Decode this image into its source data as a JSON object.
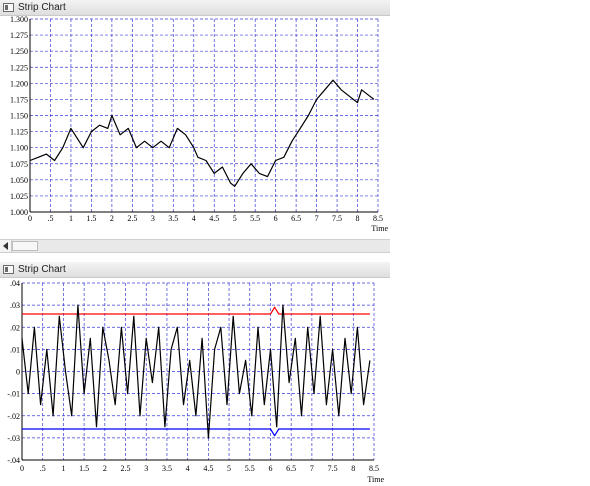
{
  "windows": [
    {
      "title": "Strip Chart"
    },
    {
      "title": "Strip Chart"
    }
  ],
  "chart_data": [
    {
      "type": "line",
      "title": "",
      "xlabel": "Time",
      "ylabel": "",
      "xlim": [
        0,
        8.5
      ],
      "ylim": [
        1.0,
        1.3
      ],
      "grid": true,
      "x_ticks": [
        "0",
        ".5",
        "1",
        "1.5",
        "2",
        "2.5",
        "3",
        "3.5",
        "4",
        "4.5",
        "5",
        "5.5",
        "6",
        "6.5",
        "7",
        "7.5",
        "8",
        "8.5"
      ],
      "y_ticks": [
        "1.000",
        "1.025",
        "1.050",
        "1.075",
        "1.100",
        "1.125",
        "1.150",
        "1.175",
        "1.200",
        "1.225",
        "1.250",
        "1.275",
        "1.300"
      ],
      "series": [
        {
          "color": "#000000",
          "x": [
            0,
            0.2,
            0.4,
            0.6,
            0.8,
            1.0,
            1.1,
            1.3,
            1.5,
            1.7,
            1.9,
            2.0,
            2.2,
            2.4,
            2.6,
            2.8,
            3.0,
            3.2,
            3.4,
            3.6,
            3.8,
            4.0,
            4.1,
            4.3,
            4.5,
            4.7,
            4.9,
            5.0,
            5.2,
            5.4,
            5.6,
            5.8,
            6.0,
            6.2,
            6.4,
            6.6,
            6.8,
            7.0,
            7.2,
            7.4,
            7.6,
            7.8,
            8.0,
            8.1,
            8.3,
            8.4
          ],
          "values": [
            1.08,
            1.085,
            1.09,
            1.08,
            1.1,
            1.13,
            1.12,
            1.1,
            1.125,
            1.135,
            1.13,
            1.15,
            1.12,
            1.13,
            1.1,
            1.11,
            1.1,
            1.11,
            1.1,
            1.13,
            1.12,
            1.1,
            1.085,
            1.08,
            1.06,
            1.07,
            1.045,
            1.04,
            1.06,
            1.075,
            1.06,
            1.055,
            1.08,
            1.085,
            1.11,
            1.13,
            1.15,
            1.175,
            1.19,
            1.205,
            1.19,
            1.18,
            1.17,
            1.19,
            1.18,
            1.175
          ]
        }
      ]
    },
    {
      "type": "line",
      "title": "",
      "xlabel": "Time",
      "ylabel": "",
      "xlim": [
        0,
        8.5
      ],
      "ylim": [
        -0.04,
        0.04
      ],
      "grid": true,
      "x_ticks": [
        "0",
        ".5",
        "1",
        "1.5",
        "2",
        "2.5",
        "3",
        "3.5",
        "4",
        "4.5",
        "5",
        "5.5",
        "6",
        "6.5",
        "7",
        "7.5",
        "8",
        "8.5"
      ],
      "y_ticks": [
        "-.04",
        "-.03",
        "-.02",
        "-.01",
        "0",
        ".01",
        ".02",
        ".03",
        ".04"
      ],
      "series": [
        {
          "color": "#ff0000",
          "x": [
            0,
            0.5,
            1,
            1.5,
            2,
            2.5,
            3,
            3.5,
            4,
            4.5,
            5,
            5.5,
            6,
            6.1,
            6.2,
            6.5,
            7,
            7.5,
            8,
            8.4
          ],
          "values": [
            0.026,
            0.026,
            0.026,
            0.026,
            0.026,
            0.026,
            0.026,
            0.026,
            0.026,
            0.026,
            0.026,
            0.026,
            0.026,
            0.029,
            0.026,
            0.026,
            0.026,
            0.026,
            0.026,
            0.026
          ]
        },
        {
          "color": "#0000ff",
          "x": [
            0,
            0.5,
            1,
            1.5,
            2,
            2.5,
            3,
            3.5,
            4,
            4.5,
            5,
            5.5,
            6,
            6.1,
            6.2,
            6.5,
            7,
            7.5,
            8,
            8.4
          ],
          "values": [
            -0.026,
            -0.026,
            -0.026,
            -0.026,
            -0.026,
            -0.026,
            -0.026,
            -0.026,
            -0.026,
            -0.026,
            -0.026,
            -0.026,
            -0.026,
            -0.029,
            -0.026,
            -0.026,
            -0.026,
            -0.026,
            -0.026,
            -0.026
          ]
        },
        {
          "color": "#000000",
          "x": [
            0,
            0.15,
            0.3,
            0.45,
            0.6,
            0.75,
            0.9,
            1.05,
            1.2,
            1.35,
            1.5,
            1.65,
            1.8,
            1.95,
            2.1,
            2.25,
            2.4,
            2.55,
            2.7,
            2.85,
            3.0,
            3.15,
            3.3,
            3.45,
            3.6,
            3.75,
            3.9,
            4.05,
            4.2,
            4.35,
            4.5,
            4.65,
            4.8,
            4.95,
            5.1,
            5.25,
            5.4,
            5.55,
            5.7,
            5.85,
            6.0,
            6.15,
            6.3,
            6.45,
            6.6,
            6.75,
            6.9,
            7.05,
            7.2,
            7.35,
            7.5,
            7.65,
            7.8,
            7.95,
            8.1,
            8.25,
            8.4
          ],
          "values": [
            0.015,
            -0.01,
            0.02,
            -0.015,
            0.01,
            -0.02,
            0.025,
            0.0,
            -0.02,
            0.03,
            -0.01,
            0.015,
            -0.025,
            0.02,
            0.005,
            -0.015,
            0.02,
            -0.01,
            0.025,
            -0.02,
            0.015,
            -0.005,
            0.02,
            -0.025,
            0.01,
            0.02,
            -0.015,
            0.005,
            -0.02,
            0.015,
            -0.03,
            0.01,
            0.02,
            -0.015,
            0.025,
            -0.01,
            0.005,
            -0.02,
            0.02,
            -0.015,
            0.01,
            -0.025,
            0.03,
            -0.005,
            0.015,
            -0.02,
            0.02,
            -0.01,
            0.025,
            -0.015,
            0.01,
            -0.02,
            0.015,
            -0.01,
            0.02,
            -0.015,
            0.005
          ]
        }
      ]
    }
  ]
}
